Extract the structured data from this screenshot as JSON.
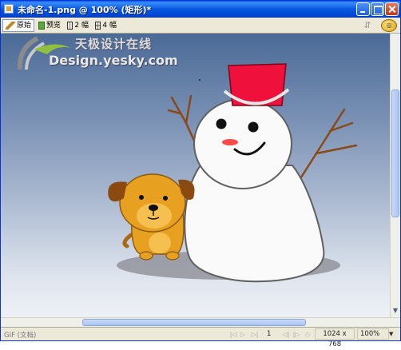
{
  "window": {
    "title": "未命名-1.png @ 100% (矩形)*"
  },
  "toolbar": {
    "tabs": [
      {
        "label": "原始",
        "icon": "pencil-icon",
        "active": true
      },
      {
        "label": "预览",
        "icon": "preview-icon",
        "active": false
      },
      {
        "label": "2 幅",
        "icon": "two-up-icon",
        "active": false
      },
      {
        "label": "4 幅",
        "icon": "four-up-icon",
        "active": false
      }
    ],
    "right_tools": [
      "quality-icon",
      "export-preview-icon"
    ]
  },
  "watermark": {
    "chinese": "天极设计在线",
    "english": "Design.yesky.com"
  },
  "status": {
    "file_type": "GIF (文档)",
    "frame": "1",
    "doc_size": "1024 x 768",
    "zoom": "100%"
  },
  "colors": {
    "title_bar": "#0a5ee8",
    "canvas_top": "#4a6a96",
    "canvas_bottom": "#eef1f6",
    "hat": "#f0103c",
    "dog": "#e8a020",
    "scarf_nose": "#ff4040"
  }
}
